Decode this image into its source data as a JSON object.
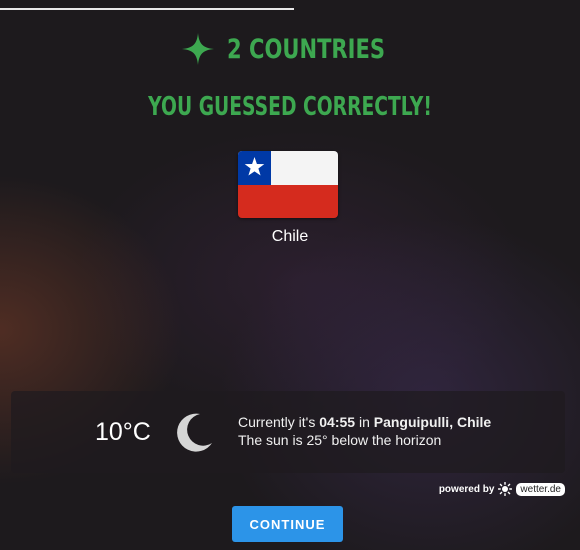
{
  "header": {
    "countries_text": "2 COUNTRIES",
    "result_text": "YOU GUESSED CORRECTLY!",
    "accent_color": "#3da850"
  },
  "answer": {
    "country": "Chile"
  },
  "weather": {
    "temperature": "10°C",
    "icon": "moon-icon",
    "line1_prefix": "Currently it's ",
    "time": "04:55",
    "line1_mid": " in ",
    "location": "Panguipulli, Chile",
    "line2": "The sun is 25° below the horizon"
  },
  "attribution": {
    "powered_by": "powered by",
    "provider": "wetter.de"
  },
  "actions": {
    "continue_label": "CONTINUE",
    "continue_color": "#2c94e8"
  }
}
